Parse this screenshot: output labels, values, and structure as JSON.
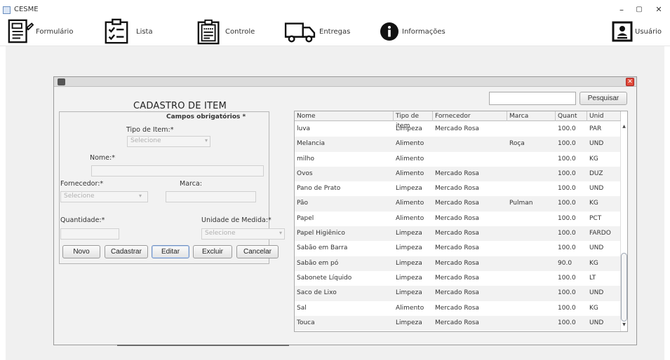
{
  "window": {
    "title": "CESME",
    "minimize": "–",
    "maximize": "▢",
    "close": "✕"
  },
  "toolbar": {
    "items": [
      {
        "label": "Formulário",
        "icon": "form-icon"
      },
      {
        "label": "Lista",
        "icon": "checklist-icon"
      },
      {
        "label": "Controle",
        "icon": "clipboard-icon"
      },
      {
        "label": "Entregas",
        "icon": "truck-icon"
      },
      {
        "label": "Informações",
        "icon": "info-icon"
      },
      {
        "label": "Usuário",
        "icon": "user-card-icon"
      }
    ]
  },
  "search": {
    "value": "",
    "button_label": "Pesquisar"
  },
  "form": {
    "title": "CADASTRO DE ITEM",
    "required_note": "Campos obrigatórios *",
    "tipo_label": "Tipo de Item:*",
    "tipo_value": "Selecione",
    "nome_label": "Nome:*",
    "nome_value": "",
    "fornecedor_label": "Fornecedor:*",
    "fornecedor_value": "Selecione",
    "marca_label": "Marca:",
    "marca_value": "",
    "quantidade_label": "Quantidade:*",
    "quantidade_value": "",
    "unidade_label": "Unidade de Medida:*",
    "unidade_value": "Selecione",
    "combo_arrow": "▾",
    "buttons": {
      "novo": "Novo",
      "cadastrar": "Cadastrar",
      "editar": "Editar",
      "excluir": "Excluir",
      "cancelar": "Cancelar"
    }
  },
  "table": {
    "columns": [
      "Nome",
      "Tipo de item",
      "Fornecedor",
      "Marca",
      "Quant",
      "Unid"
    ],
    "rows": [
      [
        "luva",
        "Limpeza",
        "Mercado Rosa",
        "",
        "100.0",
        "PAR"
      ],
      [
        "Melancia",
        "Alimento",
        "",
        "Roça",
        "100.0",
        "UND"
      ],
      [
        "milho",
        "Alimento",
        "",
        "",
        "100.0",
        "KG"
      ],
      [
        "Ovos",
        "Alimento",
        "Mercado Rosa",
        "",
        "100.0",
        "DUZ"
      ],
      [
        "Pano de Prato",
        "Limpeza",
        "Mercado Rosa",
        "",
        "100.0",
        "UND"
      ],
      [
        "Pão",
        "Alimento",
        "Mercado Rosa",
        "Pulman",
        "100.0",
        "KG"
      ],
      [
        "Papel",
        "Alimento",
        "Mercado Rosa",
        "",
        "100.0",
        "PCT"
      ],
      [
        "Papel Higiênico",
        "Limpeza",
        "Mercado Rosa",
        "",
        "100.0",
        "FARDO"
      ],
      [
        "Sabão em Barra",
        "Limpeza",
        "Mercado Rosa",
        "",
        "100.0",
        "UND"
      ],
      [
        "Sabão em pó",
        "Limpeza",
        "Mercado Rosa",
        "",
        "90.0",
        "KG"
      ],
      [
        "Sabonete Líquido",
        "Limpeza",
        "Mercado Rosa",
        "",
        "100.0",
        "LT"
      ],
      [
        "Saco de Lixo",
        "Limpeza",
        "Mercado Rosa",
        "",
        "100.0",
        "UND"
      ],
      [
        "Sal",
        "Alimento",
        "Mercado Rosa",
        "",
        "100.0",
        "KG"
      ],
      [
        "Touca",
        "Limpeza",
        "Mercado Rosa",
        "",
        "100.0",
        "UND"
      ]
    ],
    "scroll_up": "▲",
    "scroll_down": "▼"
  },
  "colors": {
    "close_button": "#e04b3a",
    "desktop_bg": "#f0f0f0",
    "focus_border": "#6f8fc0"
  }
}
